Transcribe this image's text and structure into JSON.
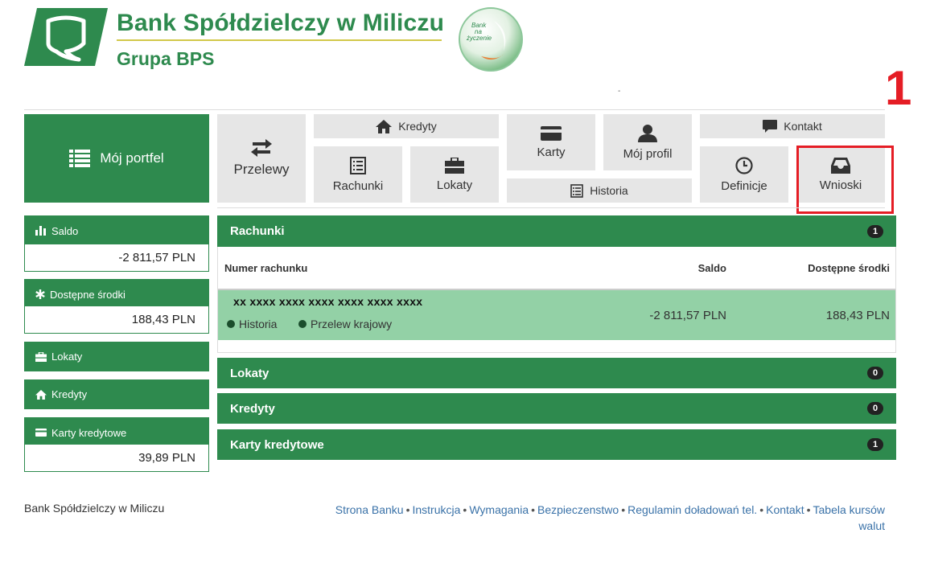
{
  "header": {
    "bank_name": "Bank Spółdzielczy w Miliczu",
    "group_name": "Grupa BPS",
    "badge_text_1": "Bank",
    "badge_text_2": "na",
    "badge_text_3": "życzenie",
    "dash": "-",
    "annotation_number": "1"
  },
  "nav": {
    "portfolio": "Mój portfel",
    "przelewy": "Przelewy",
    "kredyty": "Kredyty",
    "rachunki": "Rachunki",
    "lokaty": "Lokaty",
    "karty": "Karty",
    "historia": "Historia",
    "moj_profil": "Mój profil",
    "kontakt": "Kontakt",
    "definicje": "Definicje",
    "wnioski": "Wnioski"
  },
  "sidebar": {
    "saldo_label": "Saldo",
    "saldo_value": "-2 811,57 PLN",
    "dostepne_label": "Dostępne środki",
    "dostepne_value": "188,43 PLN",
    "lokaty_label": "Lokaty",
    "kredyty_label": "Kredyty",
    "karty_label": "Karty kredytowe",
    "karty_value": "39,89 PLN"
  },
  "main": {
    "rachunki": {
      "title": "Rachunki",
      "count": "1"
    },
    "columns": {
      "numer": "Numer rachunku",
      "saldo": "Saldo",
      "dostepne": "Dostępne środki"
    },
    "account": {
      "number": "xx xxxx xxxx xxxx xxxx xxxx xxxx",
      "link_historia": "Historia",
      "link_przelew": "Przelew krajowy",
      "saldo": "-2 811,57 PLN",
      "dostepne": "188,43 PLN"
    },
    "lokaty": {
      "title": "Lokaty",
      "count": "0"
    },
    "kredyty": {
      "title": "Kredyty",
      "count": "0"
    },
    "karty": {
      "title": "Karty kredytowe",
      "count": "1"
    }
  },
  "footer": {
    "bank": "Bank Spółdzielczy w Miliczu",
    "links": [
      "Strona Banku",
      "Instrukcja",
      "Wymagania",
      "Bezpieczenstwo",
      "Regulamin doładowań tel.",
      "Kontakt",
      "Tabela kursów walut"
    ],
    "separator": "•"
  },
  "colors": {
    "brand_green": "#2e8a4e",
    "row_green": "#93d1a6",
    "tile_gray": "#e6e6e6",
    "annotation_red": "#e51d25"
  }
}
